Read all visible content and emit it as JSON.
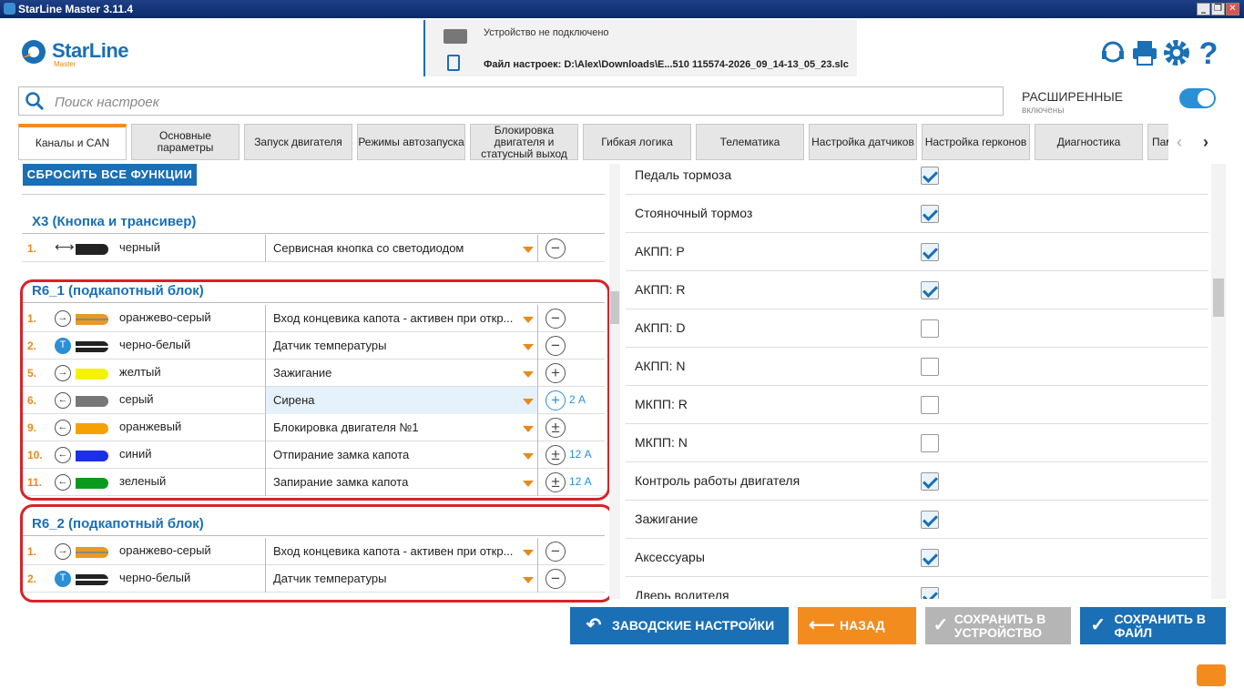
{
  "window": {
    "title": "StarLine Master 3.11.4",
    "min": "_",
    "max": "❐",
    "close": "✕"
  },
  "logo": {
    "name": "StarLine",
    "sub": "Master"
  },
  "device": {
    "status": "Устройство не подключено",
    "file": "Файл настроек: D:\\Alex\\Downloads\\E...510 115574-2026_09_14-13_05_23.slc"
  },
  "search": {
    "placeholder": "Поиск настроек"
  },
  "advanced": {
    "label": "РАСШИРЕННЫЕ",
    "sub": "включены"
  },
  "tabs": [
    "Каналы и CAN",
    "Основные параметры",
    "Запуск двигателя",
    "Режимы автозапуска",
    "Блокировка двигателя и статусный выход",
    "Гибкая логика",
    "Телематика",
    "Настройка датчиков",
    "Настройка герконов",
    "Диагностика",
    "Пам"
  ],
  "reset_button": "СБРОСИТЬ ВСЕ ФУНКЦИИ",
  "sections": [
    {
      "title": "X3 (Кнопка и трансивер)",
      "rows": [
        {
          "num": "1.",
          "wire": "черный",
          "func": "Сервисная кнопка со светодиодом",
          "pm": "−",
          "amp": ""
        }
      ]
    },
    {
      "title": "R6_1 (подкапотный блок)",
      "rows": [
        {
          "num": "1.",
          "wire": "оранжево-серый",
          "func": "Вход концевика капота - активен при откр...",
          "pm": "−",
          "amp": ""
        },
        {
          "num": "2.",
          "wire": "черно-белый",
          "func": "Датчик температуры",
          "pm": "−",
          "amp": ""
        },
        {
          "num": "5.",
          "wire": "желтый",
          "func": "Зажигание",
          "pm": "+",
          "amp": ""
        },
        {
          "num": "6.",
          "wire": "серый",
          "func": "Сирена",
          "pm": "+",
          "amp": "2 А"
        },
        {
          "num": "9.",
          "wire": "оранжевый",
          "func": "Блокировка двигателя №1",
          "pm": "±",
          "amp": ""
        },
        {
          "num": "10.",
          "wire": "синий",
          "func": "Отпирание замка капота",
          "pm": "±",
          "amp": "12 А"
        },
        {
          "num": "11.",
          "wire": "зеленый",
          "func": "Запирание замка капота",
          "pm": "±",
          "amp": "12 А"
        }
      ]
    },
    {
      "title": "R6_2 (подкапотный блок)",
      "rows": [
        {
          "num": "1.",
          "wire": "оранжево-серый",
          "func": "Вход концевика капота - активен при откр...",
          "pm": "−",
          "amp": ""
        },
        {
          "num": "2.",
          "wire": "черно-белый",
          "func": "Датчик температуры",
          "pm": "−",
          "amp": ""
        }
      ]
    }
  ],
  "right_list": [
    {
      "label": "Педаль тормоза",
      "checked": true
    },
    {
      "label": "Стояночный тормоз",
      "checked": true
    },
    {
      "label": "АКПП: P",
      "checked": true
    },
    {
      "label": "АКПП: R",
      "checked": true
    },
    {
      "label": "АКПП: D",
      "checked": false
    },
    {
      "label": "АКПП: N",
      "checked": false
    },
    {
      "label": "МКПП: R",
      "checked": false
    },
    {
      "label": "МКПП: N",
      "checked": false
    },
    {
      "label": "Контроль работы двигателя",
      "checked": true
    },
    {
      "label": "Зажигание",
      "checked": true
    },
    {
      "label": "Аксессуары",
      "checked": true
    },
    {
      "label": "Дверь водителя",
      "checked": true
    }
  ],
  "buttons": {
    "factory": "ЗАВОДСКИЕ НАСТРОЙКИ",
    "back": "НАЗАД",
    "save_device": "СОХРАНИТЬ В УСТРОЙСТВО",
    "save_file": "СОХРАНИТЬ В ФАЙЛ"
  },
  "colors": {
    "accent": "#1a6fb5",
    "orange": "#f28c1e",
    "red_box": "#d6232a",
    "disabled": "#b5b5b5"
  }
}
